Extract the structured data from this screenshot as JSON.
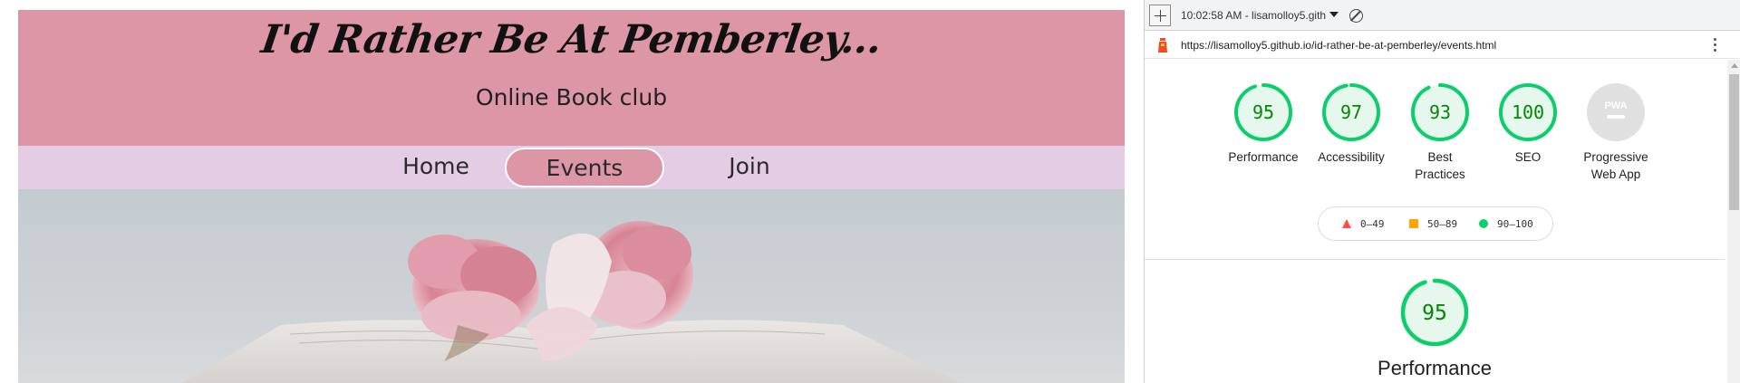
{
  "site": {
    "title": "I'd Rather Be At Pemberley...",
    "subtitle": "Online Book club",
    "nav": [
      {
        "label": "Home",
        "active": false
      },
      {
        "label": "Events",
        "active": true
      },
      {
        "label": "Join",
        "active": false
      }
    ],
    "colors": {
      "header": "#dc96a6",
      "nav": "#e4cce4",
      "active_pill": "#dc96a6"
    }
  },
  "devtools": {
    "toolbar": {
      "new_report_icon": "plus-icon",
      "report_label": "10:02:58 AM - lisamolloy5.gith",
      "clear_icon": "block-icon"
    },
    "url": "https://lisamolloy5.github.io/id-rather-be-at-pemberley/events.html",
    "scores": [
      {
        "label": "Performance",
        "value": "95",
        "score": 0.95
      },
      {
        "label": "Accessibility",
        "value": "97",
        "score": 0.97
      },
      {
        "label": "Best Practices",
        "value": "93",
        "score": 0.93
      },
      {
        "label": "SEO",
        "value": "100",
        "score": 1.0
      },
      {
        "label": "Progressive Web App",
        "value": "PWA",
        "score": null
      }
    ],
    "legend": [
      {
        "range": "0–49",
        "color": "#ff4e42",
        "icon": "triangle-icon"
      },
      {
        "range": "50–89",
        "color": "#ffa400",
        "icon": "square-icon"
      },
      {
        "range": "90–100",
        "color": "#0cce6b",
        "icon": "circle-icon"
      }
    ],
    "section": {
      "value": "95",
      "score": 0.95,
      "title": "Performance"
    },
    "colors": {
      "pass": "#0cce6b",
      "pass_text": "#008800",
      "pass_fill": "#e6f8ed",
      "na": "#e0e0e0"
    }
  }
}
